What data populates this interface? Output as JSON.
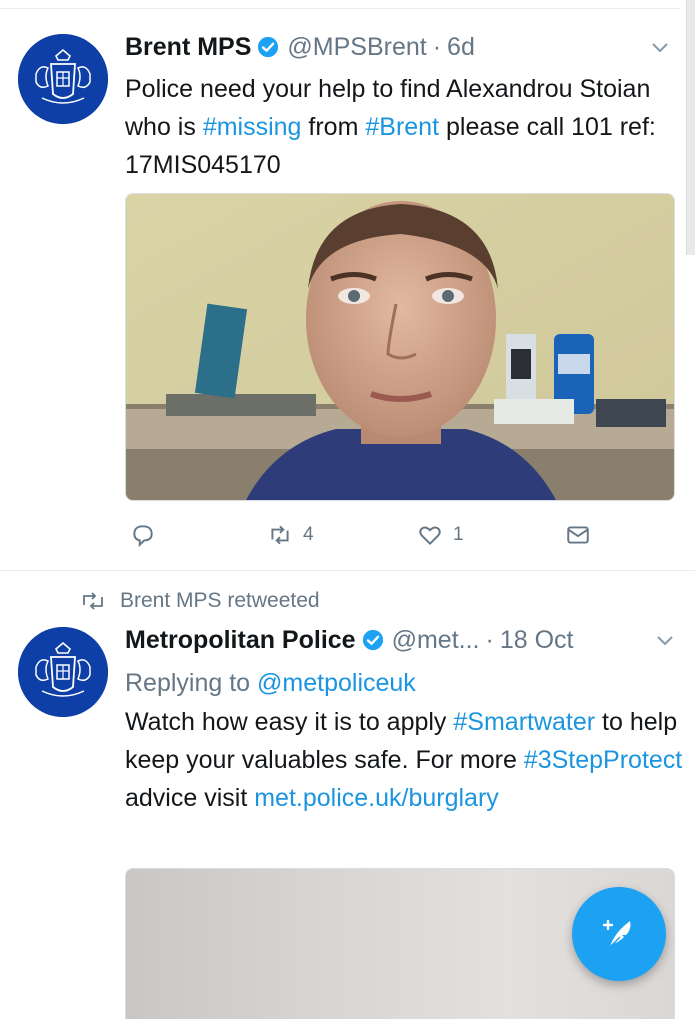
{
  "tweets": [
    {
      "author_name": "Brent MPS",
      "handle": "@MPSBrent",
      "separator": "·",
      "time": "6d",
      "text_before": "Police need your help to find Alexandrou Stoian who is ",
      "hashtag1": "#missing",
      "text_mid": " from ",
      "hashtag2": "#Brent",
      "text_after": " please call 101 ref: 17MIS045170",
      "reply_count": "",
      "retweet_count": "4",
      "like_count": "1"
    },
    {
      "retweet_label": "Brent MPS retweeted",
      "author_name": "Metropolitan Police",
      "handle": "@met...",
      "separator": "·",
      "time": "18 Oct",
      "replying_prefix": "Replying to ",
      "replying_to": "@metpoliceuk",
      "text_before": "Watch how easy it is to apply ",
      "hashtag1": "#Smartwater",
      "text_mid": " to help keep your valuables safe. For more ",
      "hashtag2": "#3StepProtect",
      "text_after": " advice visit ",
      "link": "met.police.uk/burglary"
    }
  ],
  "colors": {
    "accent": "#1da1f2",
    "link": "#1b95e0",
    "muted": "#657786",
    "avatar_bg": "#0e3fa6"
  },
  "icons": [
    "verified-badge-icon",
    "chevron-down-icon",
    "reply-icon",
    "retweet-icon",
    "like-icon",
    "direct-message-icon",
    "compose-tweet-icon"
  ]
}
